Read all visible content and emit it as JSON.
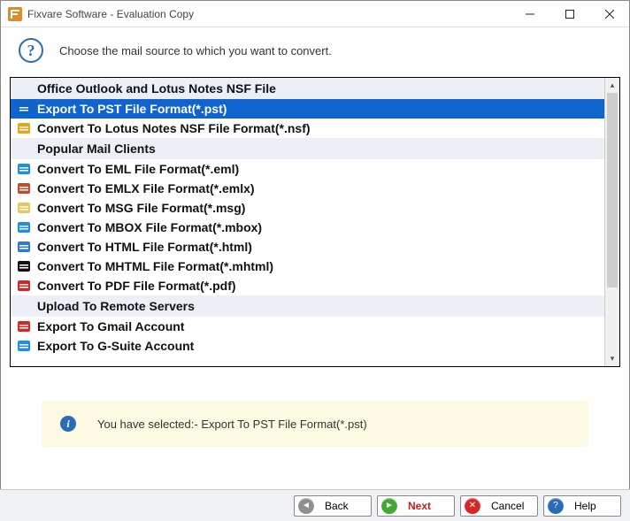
{
  "window": {
    "title": "Fixvare Software - Evaluation Copy"
  },
  "header": {
    "prompt": "Choose the mail source to which you want to convert."
  },
  "list": {
    "sections": [
      {
        "header": "Office Outlook and Lotus Notes NSF File",
        "items": [
          {
            "label": "Export To PST File Format(*.pst)",
            "selected": true,
            "icon": "pst-icon",
            "color": "#0a66c2"
          },
          {
            "label": "Convert To Lotus Notes NSF File Format(*.nsf)",
            "icon": "nsf-icon",
            "color": "#e4a817"
          }
        ]
      },
      {
        "header": "Popular Mail Clients",
        "items": [
          {
            "label": "Convert To EML File Format(*.eml)",
            "icon": "eml-icon",
            "color": "#1a8fe3"
          },
          {
            "label": "Convert To EMLX File Format(*.emlx)",
            "icon": "emlx-icon",
            "color": "#c44a2f"
          },
          {
            "label": "Convert To MSG File Format(*.msg)",
            "icon": "msg-icon",
            "color": "#e4c95a"
          },
          {
            "label": "Convert To MBOX File Format(*.mbox)",
            "icon": "mbox-icon",
            "color": "#1a8fe3"
          },
          {
            "label": "Convert To HTML File Format(*.html)",
            "icon": "html-icon",
            "color": "#2f78d1"
          },
          {
            "label": "Convert To MHTML File Format(*.mhtml)",
            "icon": "mhtml-icon",
            "color": "#111"
          },
          {
            "label": "Convert To PDF File Format(*.pdf)",
            "icon": "pdf-icon",
            "color": "#d62626"
          }
        ]
      },
      {
        "header": "Upload To Remote Servers",
        "items": [
          {
            "label": "Export To Gmail Account",
            "icon": "gmail-icon",
            "color": "#d62626"
          },
          {
            "label": "Export To G-Suite Account",
            "icon": "gsuite-icon",
            "color": "#1a8fe3"
          }
        ]
      }
    ]
  },
  "notice": {
    "text": "You have selected:- Export To PST File Format(*.pst)"
  },
  "footer": {
    "back": "Back",
    "next": "Next",
    "cancel": "Cancel",
    "help": "Help"
  }
}
